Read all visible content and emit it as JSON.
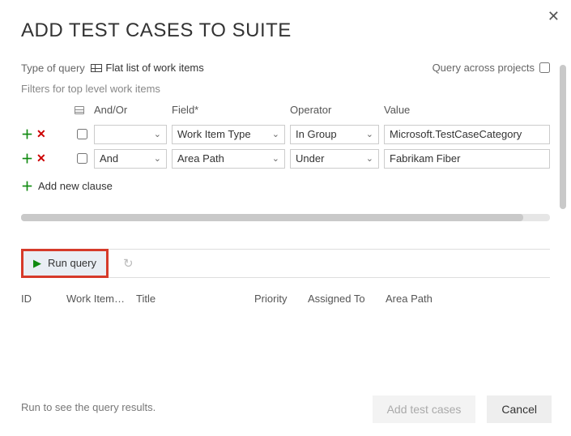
{
  "title": "ADD TEST CASES TO SUITE",
  "top": {
    "type_of_query_label": "Type of query",
    "type_of_query_value": "Flat list of work items",
    "query_across_label": "Query across projects",
    "query_across_checked": false
  },
  "filters": {
    "section_label": "Filters for top level work items",
    "headers": {
      "andor": "And/Or",
      "field": "Field*",
      "operator": "Operator",
      "value": "Value"
    },
    "rows": [
      {
        "checked": false,
        "andor": "",
        "field": "Work Item Type",
        "operator": "In Group",
        "value": "Microsoft.TestCaseCategory"
      },
      {
        "checked": false,
        "andor": "And",
        "field": "Area Path",
        "operator": "Under",
        "value": "Fabrikam Fiber"
      }
    ],
    "add_clause_label": "Add new clause"
  },
  "toolbar": {
    "run_query_label": "Run query"
  },
  "columns": {
    "id": "ID",
    "work_item": "Work Item…",
    "title": "Title",
    "priority": "Priority",
    "assigned_to": "Assigned To",
    "area_path": "Area Path"
  },
  "results_message": "Run to see the query results.",
  "footer": {
    "add_label": "Add test cases",
    "cancel_label": "Cancel"
  }
}
